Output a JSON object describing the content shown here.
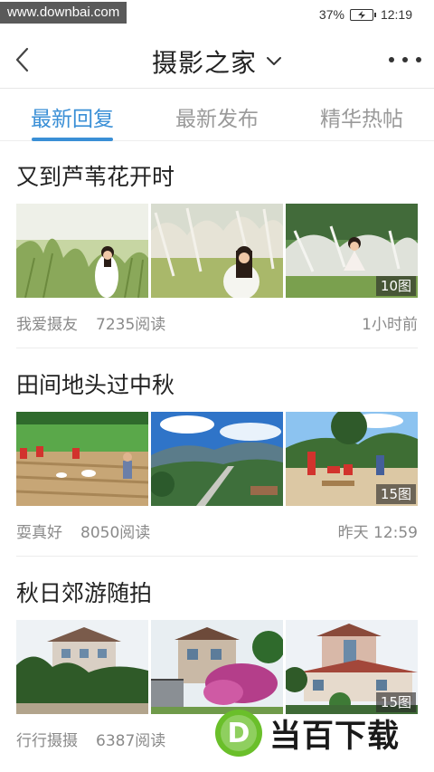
{
  "status_bar": {
    "watermark": "www.downbai.com",
    "battery_percent": "37%",
    "time": "12:19"
  },
  "header": {
    "title": "摄影之家"
  },
  "tabs": [
    {
      "label": "最新回复",
      "active": true
    },
    {
      "label": "最新发布",
      "active": false
    },
    {
      "label": "精华热帖",
      "active": false
    }
  ],
  "posts": [
    {
      "title": "又到芦苇花开时",
      "author": "我爱摄友",
      "reads": "7235阅读",
      "time": "1小时前",
      "image_count": "10图"
    },
    {
      "title": "田间地头过中秋",
      "author": "耍真好",
      "reads": "8050阅读",
      "time": "昨天 12:59",
      "image_count": "15图"
    },
    {
      "title": "秋日郊游随拍",
      "author": "行行摄摄",
      "reads": "6387阅读",
      "time": "",
      "image_count": "15图"
    }
  ],
  "overlay_logo": {
    "text": "当百下载",
    "mark": "D"
  },
  "colors": {
    "accent": "#3a8fd6",
    "logo_green": "#6abf2a"
  }
}
